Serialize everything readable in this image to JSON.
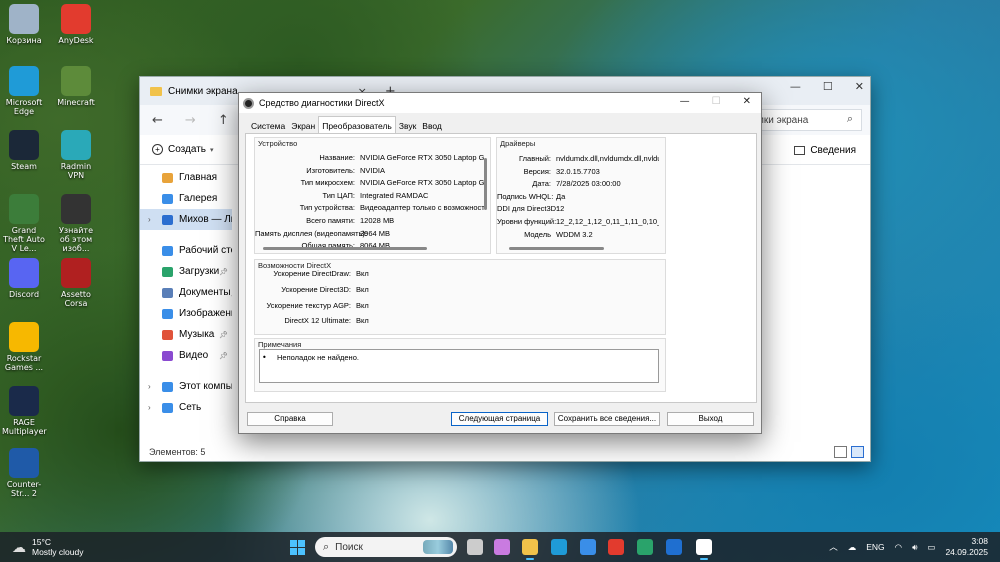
{
  "desktop_icons": [
    {
      "label": "Корзина",
      "icon": "recycle-bin-icon",
      "color": "#9fb3c8"
    },
    {
      "label": "AnyDesk",
      "icon": "anydesk-icon",
      "color": "#e23b2e"
    },
    {
      "label": "Microsoft Edge",
      "icon": "edge-icon",
      "color": "#1f9bd7"
    },
    {
      "label": "Minecraft",
      "icon": "minecraft-icon",
      "color": "#5d8b3a"
    },
    {
      "label": "Steam",
      "icon": "steam-icon",
      "color": "#1b2838"
    },
    {
      "label": "Radmin VPN",
      "icon": "radmin-vpn-icon",
      "color": "#2aa9b8"
    },
    {
      "label": "Grand Theft Auto V Le...",
      "icon": "gta-icon",
      "color": "#3c7d3a"
    },
    {
      "label": "Узнайте об этом изоб...",
      "icon": "camera-icon",
      "color": "#333333"
    },
    {
      "label": "Discord",
      "icon": "discord-icon",
      "color": "#5865f2"
    },
    {
      "label": "Assetto Corsa",
      "icon": "assetto-corsa-icon",
      "color": "#b02020"
    },
    {
      "label": "Rockstar Games ...",
      "icon": "rockstar-icon",
      "color": "#f7b800"
    },
    {
      "label": "RAGE Multiplayer",
      "icon": "rage-mp-icon",
      "color": "#1a2a4a"
    },
    {
      "label": "Counter-Str... 2",
      "icon": "cs2-icon",
      "color": "#1f5aa8"
    }
  ],
  "explorer": {
    "title": "Снимки экрана",
    "close_glyph": "×",
    "new_tab_glyph": "+",
    "search_placeholder": "мки экрана",
    "create_label": "Создать",
    "details_label": "Сведения",
    "sidebar": [
      {
        "label": "Главная",
        "icon": "home-icon",
        "color": "#e8a33a"
      },
      {
        "label": "Галерея",
        "icon": "gallery-icon",
        "color": "#3a8ee8"
      },
      {
        "label": "Михов — Личн",
        "icon": "onedrive-icon",
        "color": "#2b6ed0",
        "selected": true
      },
      {
        "label": "Рабочий сто",
        "icon": "desktop-icon",
        "color": "#3a8ee8",
        "pinned": true
      },
      {
        "label": "Загрузки",
        "icon": "downloads-icon",
        "color": "#2aa36b",
        "pinned": true
      },
      {
        "label": "Документы",
        "icon": "documents-icon",
        "color": "#5a7fb8",
        "pinned": true
      },
      {
        "label": "Изображени",
        "icon": "pictures-icon",
        "color": "#3a8ee8",
        "pinned": true
      },
      {
        "label": "Музыка",
        "icon": "music-icon",
        "color": "#e0533a",
        "pinned": true
      },
      {
        "label": "Видео",
        "icon": "videos-icon",
        "color": "#8a4ad0",
        "pinned": true
      },
      {
        "label": "Этот компьюте",
        "icon": "this-pc-icon",
        "color": "#3a8ee8"
      },
      {
        "label": "Сеть",
        "icon": "network-icon",
        "color": "#3a8ee8"
      }
    ],
    "status": "Элементов: 5"
  },
  "dxdiag": {
    "title": "Средство диагностики DirectX",
    "tabs": [
      "Система",
      "Экран",
      "Преобразователь",
      "Звук",
      "Ввод"
    ],
    "active_tab": "Преобразователь",
    "device_group": "Устройство",
    "device": [
      {
        "key": "Название:",
        "value": "NVIDIA GeForce RTX 3050 Laptop GF"
      },
      {
        "key": "Изготовитель:",
        "value": "NVIDIA"
      },
      {
        "key": "Тип микросхем:",
        "value": "NVIDIA GeForce RTX 3050 Laptop GF"
      },
      {
        "key": "Тип ЦАП:",
        "value": "Integrated RAMDAC"
      },
      {
        "key": "Тип устройства:",
        "value": "Видеоадаптер только с возможност"
      },
      {
        "key": "Всего памяти:",
        "value": "12028 MB"
      },
      {
        "key": "Память дисплея (видеопамять):",
        "value": "3964 MB"
      },
      {
        "key": "Общая память:",
        "value": "8064 MB"
      }
    ],
    "drivers_group": "Драйверы",
    "drivers": [
      {
        "key": "Главный:",
        "value": "nvldumdx.dll,nvldumdx.dll,nvldumdx.d"
      },
      {
        "key": "Версия:",
        "value": "32.0.15.7703"
      },
      {
        "key": "Дата:",
        "value": "7/28/2025 03:00:00"
      },
      {
        "key": "Подпись WHQL:",
        "value": "Да"
      },
      {
        "key": "DDI для Direct3D:",
        "value": "12"
      },
      {
        "key": "Уровни функций:",
        "value": "12_2,12_1,12_0,11_1,11_0,10_1,10_"
      },
      {
        "key": "Модель",
        "value": "WDDM 3.2"
      }
    ],
    "features_group": "Возможности DirectX",
    "features": [
      {
        "key": "Ускорение DirectDraw:",
        "value": "Вкл"
      },
      {
        "key": "Ускорение Direct3D:",
        "value": "Вкл"
      },
      {
        "key": "Ускорение текстур AGP:",
        "value": "Вкл"
      },
      {
        "key": "DirectX 12 Ultimate:",
        "value": "Вкл"
      }
    ],
    "notes_group": "Примечания",
    "notes": "Неполадок не найдено.",
    "buttons": {
      "help": "Справка",
      "next": "Следующая страница",
      "save": "Сохранить все сведения...",
      "exit": "Выход"
    }
  },
  "taskbar": {
    "weather_temp": "15°C",
    "weather_desc": "Mostly cloudy",
    "search_placeholder": "Поиск",
    "apps": [
      {
        "name": "task-view-icon",
        "color": "#cccccc"
      },
      {
        "name": "copilot-icon",
        "color": "#c97be0"
      },
      {
        "name": "file-explorer-icon",
        "color": "#f1c24a",
        "active": true
      },
      {
        "name": "edge-icon",
        "color": "#1f9bd7"
      },
      {
        "name": "store-icon",
        "color": "#3a8ee8"
      },
      {
        "name": "anydesk-icon",
        "color": "#e23b2e"
      },
      {
        "name": "chrome-icon",
        "color": "#2aa36b"
      },
      {
        "name": "outlook-icon",
        "color": "#1f6fd0"
      },
      {
        "name": "dxdiag-icon",
        "color": "#ffffff",
        "active": true
      }
    ],
    "language": "ENG",
    "time": "3:08",
    "date": "24.09.2025"
  }
}
